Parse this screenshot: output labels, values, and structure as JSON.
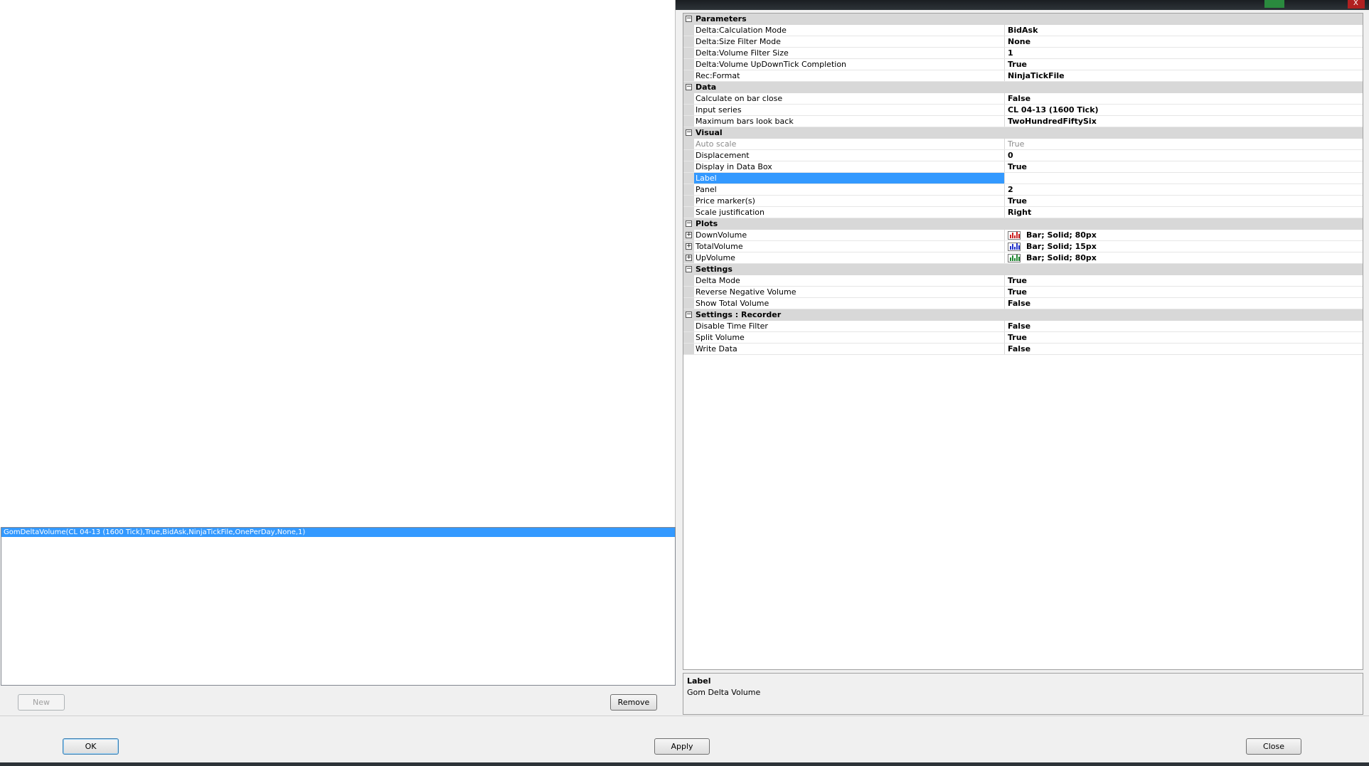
{
  "top_bar": {
    "close_glyph": "X"
  },
  "left": {
    "list_items": [
      "GomDeltaVolume(CL 04-13 (1600 Tick),True,BidAsk,NinjaTickFile,OnePerDay,None,1)"
    ],
    "new_label": "New",
    "remove_label": "Remove"
  },
  "grid": {
    "cat_parameters": "Parameters",
    "cat_data": "Data",
    "cat_visual": "Visual",
    "cat_plots": "Plots",
    "cat_settings": "Settings",
    "cat_recorder": "Settings : Recorder",
    "collapse_glyph": "−",
    "expand_glyph": "+",
    "parameters": [
      {
        "name": "Delta:Calculation Mode",
        "value": "BidAsk"
      },
      {
        "name": "Delta:Size Filter Mode",
        "value": "None"
      },
      {
        "name": "Delta:Volume Filter Size",
        "value": "1"
      },
      {
        "name": "Delta:Volume UpDownTick Completion",
        "value": "True"
      },
      {
        "name": "Rec:Format",
        "value": "NinjaTickFile"
      }
    ],
    "data": [
      {
        "name": "Calculate on bar close",
        "value": "False"
      },
      {
        "name": "Input series",
        "value": "CL 04-13 (1600 Tick)"
      },
      {
        "name": "Maximum bars look back",
        "value": "TwoHundredFiftySix"
      }
    ],
    "visual": [
      {
        "name": "Auto scale",
        "value": "True"
      },
      {
        "name": "Displacement",
        "value": "0"
      },
      {
        "name": "Display in Data Box",
        "value": "True"
      },
      {
        "name": "Label",
        "value": ""
      },
      {
        "name": "Panel",
        "value": "2"
      },
      {
        "name": "Price marker(s)",
        "value": "True"
      },
      {
        "name": "Scale justification",
        "value": "Right"
      }
    ],
    "plots": [
      {
        "name": "DownVolume",
        "value": "Bar; Solid; 80px",
        "color": "#cc2222"
      },
      {
        "name": "TotalVolume",
        "value": "Bar; Solid; 15px",
        "color": "#2233cc"
      },
      {
        "name": "UpVolume",
        "value": "Bar; Solid; 80px",
        "color": "#228833"
      }
    ],
    "settings": [
      {
        "name": "Delta Mode",
        "value": "True"
      },
      {
        "name": "Reverse Negative Volume",
        "value": "True"
      },
      {
        "name": "Show Total Volume",
        "value": "False"
      }
    ],
    "recorder": [
      {
        "name": "Disable Time Filter",
        "value": "False"
      },
      {
        "name": "Split Volume",
        "value": "True"
      },
      {
        "name": "Write Data",
        "value": "False"
      }
    ]
  },
  "description": {
    "title": "Label",
    "text": "Gom Delta Volume"
  },
  "footer": {
    "ok_label": "OK",
    "apply_label": "Apply",
    "close_label": "Close"
  }
}
